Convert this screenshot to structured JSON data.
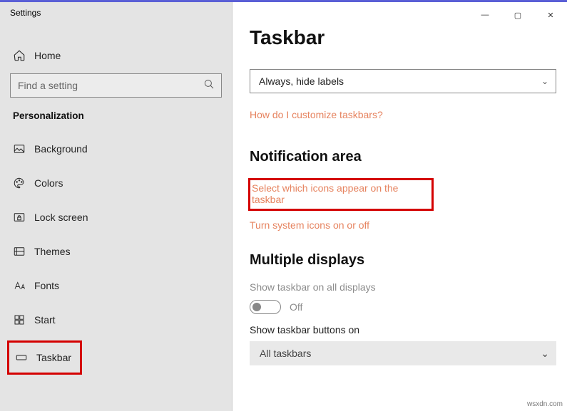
{
  "caption": "Settings",
  "window_controls": {
    "minimize": "—",
    "maximize": "▢",
    "close": "✕"
  },
  "sidebar": {
    "home_label": "Home",
    "search_placeholder": "Find a setting",
    "section": "Personalization",
    "items": [
      {
        "label": "Background"
      },
      {
        "label": "Colors"
      },
      {
        "label": "Lock screen"
      },
      {
        "label": "Themes"
      },
      {
        "label": "Fonts"
      },
      {
        "label": "Start"
      },
      {
        "label": "Taskbar",
        "selected": true
      }
    ]
  },
  "main": {
    "title": "Taskbar",
    "combine_dropdown": "Always, hide labels",
    "customize_link": "How do I customize taskbars?",
    "notification_heading": "Notification area",
    "select_icons_link": "Select which icons appear on the taskbar",
    "system_icons_link": "Turn system icons on or off",
    "multiple_heading": "Multiple displays",
    "show_all_label": "Show taskbar on all displays",
    "toggle_state": "Off",
    "show_buttons_label": "Show taskbar buttons on",
    "show_buttons_value": "All taskbars"
  },
  "watermark": "wsxdn.com"
}
